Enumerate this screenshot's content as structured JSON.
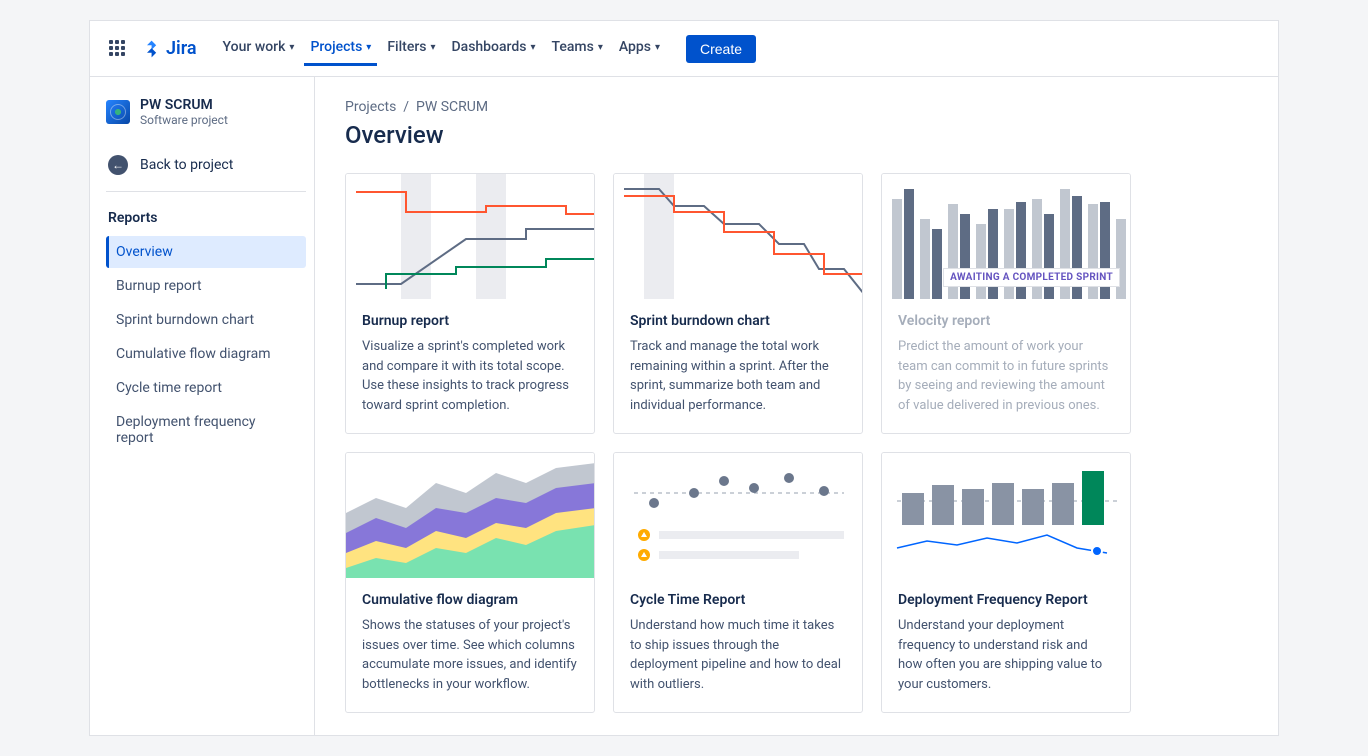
{
  "app": {
    "name": "Jira"
  },
  "nav": {
    "your_work": "Your work",
    "projects": "Projects",
    "filters": "Filters",
    "dashboards": "Dashboards",
    "teams": "Teams",
    "apps": "Apps",
    "create": "Create"
  },
  "project": {
    "name": "PW SCRUM",
    "type": "Software project"
  },
  "sidebar": {
    "back": "Back to project",
    "section": "Reports",
    "items": [
      "Overview",
      "Burnup report",
      "Sprint burndown chart",
      "Cumulative flow diagram",
      "Cycle time report",
      "Deployment frequency report"
    ]
  },
  "breadcrumb": {
    "root": "Projects",
    "current": "PW SCRUM"
  },
  "page_title": "Overview",
  "cards": [
    {
      "title": "Burnup report",
      "desc": "Visualize a sprint's completed work and compare it with its total scope. Use these insights to track progress toward sprint completion."
    },
    {
      "title": "Sprint burndown chart",
      "desc": "Track and manage the total work remaining within a sprint. After the sprint, summarize both team and individual performance."
    },
    {
      "title": "Velocity report",
      "desc": "Predict the amount of work your team can commit to in future sprints by seeing and reviewing the amount of value delivered in previous ones.",
      "badge": "AWAITING A COMPLETED SPRINT"
    },
    {
      "title": "Cumulative flow diagram",
      "desc": "Shows the statuses of your project's issues over time. See which columns accumulate more issues, and identify bottlenecks in your workflow."
    },
    {
      "title": "Cycle Time Report",
      "desc": "Understand how much time it takes to ship issues through the deployment pipeline and how to deal with outliers."
    },
    {
      "title": "Deployment Frequency Report",
      "desc": "Understand your deployment frequency to understand risk and how often you are shipping value to your customers."
    }
  ]
}
